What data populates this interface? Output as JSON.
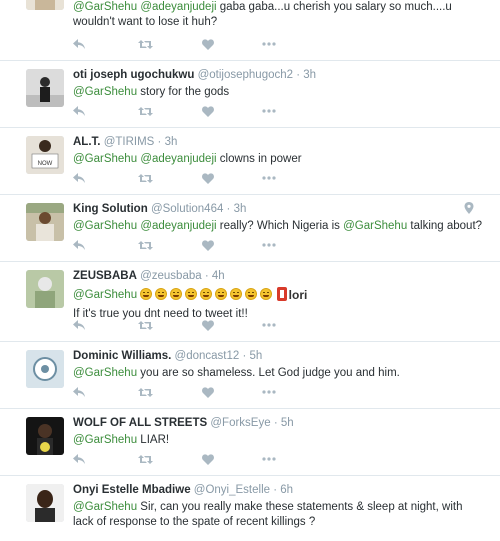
{
  "colors": {
    "mention": "#3c8d3c",
    "meta": "#8899a6",
    "text": "#292f33",
    "divider": "#e1e8ed"
  },
  "tweets": [
    {
      "name": "",
      "handle": "",
      "time": "",
      "line1_parts": [
        "@GarShehu",
        " ",
        "@adeyanjudeji",
        " gaba gaba...u cherish you salary so much....u"
      ],
      "line2": "wouldn't want to lose it huh?"
    },
    {
      "name": "oti joseph ugochukwu",
      "handle": "@otijosephugoch2",
      "time": "3h",
      "line1_parts": [
        "@GarShehu",
        " story for the gods"
      ]
    },
    {
      "name": "AL.T.",
      "handle": "@TIRIMS",
      "time": "3h",
      "line1_parts": [
        "@GarShehu",
        " ",
        "@adeyanjudeji",
        "  clowns in power"
      ],
      "avatar_sign": "NOW"
    },
    {
      "name": "King Solution",
      "handle": "@Solution464",
      "time": "3h",
      "line1_parts": [
        "@GarShehu",
        " ",
        "@adeyanjudeji",
        " really? Which Nigeria is ",
        "@GarShehu",
        " talking about?"
      ],
      "location_icon": "location-pin-icon"
    },
    {
      "name": "ZEUSBABA",
      "handle": "@zeusbaba",
      "time": "4h",
      "line1_parts": [
        "@GarShehu"
      ],
      "emoji_count": 9,
      "emoji_name": "grinning-face-icon",
      "logo_text": "lori",
      "line2": "If it's true you dnt need to tweet it!!"
    },
    {
      "name": "Dominic Williams.",
      "handle": "@doncast12",
      "time": "5h",
      "line1_parts": [
        "@GarShehu",
        " you are so shameless. Let God judge you and him."
      ]
    },
    {
      "name": "WOLF OF ALL STREETS",
      "handle": "@ForksEye",
      "time": "5h",
      "line1_parts": [
        "@GarShehu",
        " LIAR!"
      ]
    },
    {
      "name": "Onyi Estelle Mbadiwe",
      "handle": "@Onyi_Estelle",
      "time": "6h",
      "line1_parts": [
        "@GarShehu",
        " Sir, can you really make these statements & sleep at night, with"
      ],
      "line2": "lack of response to the spate of recent killings ?"
    }
  ],
  "actions": {
    "reply": "reply-icon",
    "retweet": "retweet-icon",
    "like": "heart-icon",
    "more": "more-icon"
  }
}
